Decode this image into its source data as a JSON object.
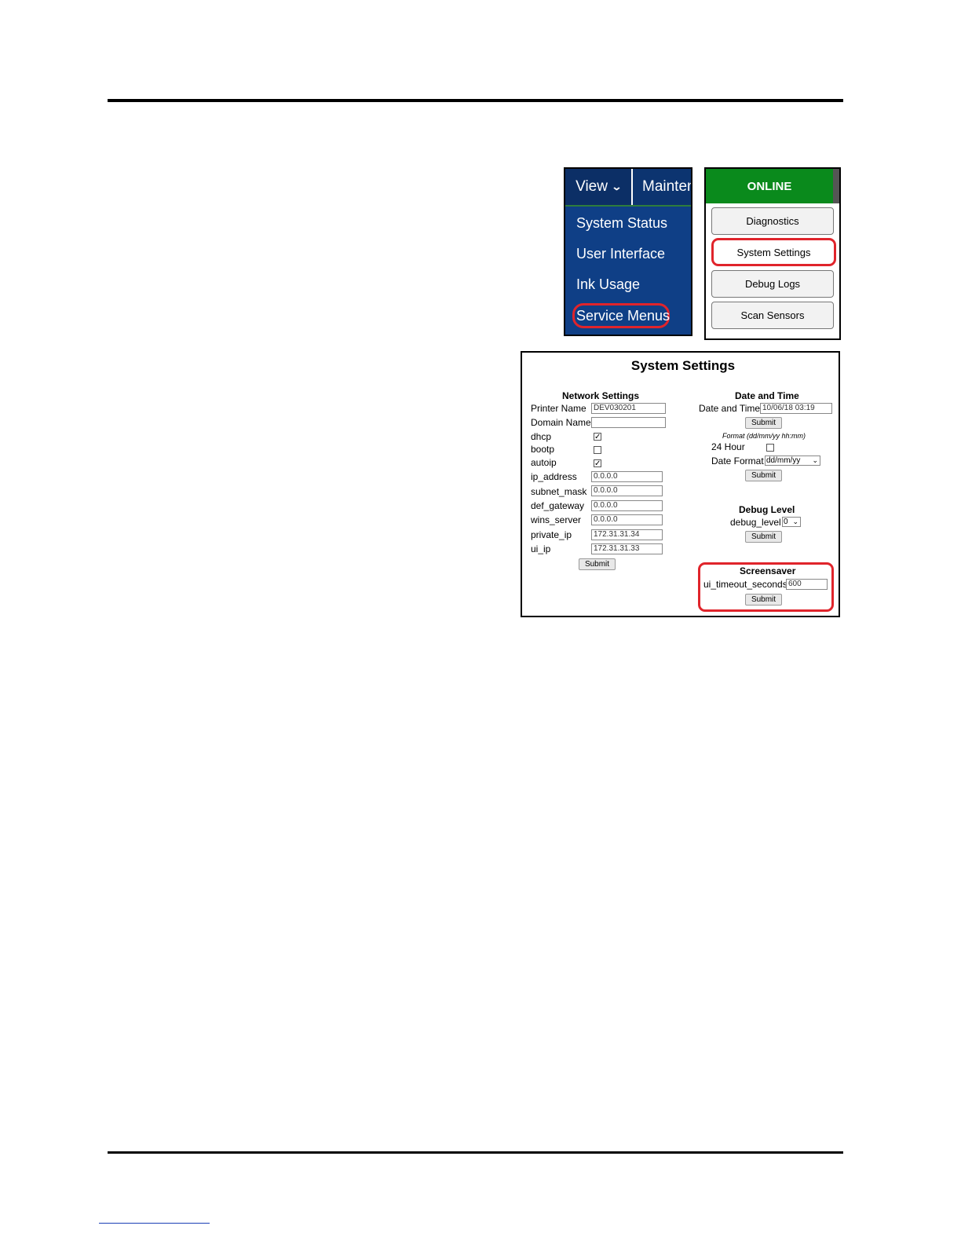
{
  "view_menu": {
    "view_label": "View",
    "maintenance_label": "Mainten",
    "items": [
      "System Status",
      "User Interface",
      "Ink Usage",
      "Service Menus"
    ]
  },
  "online_panel": {
    "status": "ONLINE",
    "buttons": [
      "Diagnostics",
      "System Settings",
      "Debug Logs",
      "Scan Sensors"
    ]
  },
  "system_settings": {
    "title": "System Settings",
    "network": {
      "heading": "Network Settings",
      "printer_name_label": "Printer Name",
      "printer_name_value": "DEV030201",
      "domain_name_label": "Domain Name",
      "domain_name_value": "",
      "dhcp_label": "dhcp",
      "dhcp_checked": true,
      "bootp_label": "bootp",
      "bootp_checked": false,
      "autoip_label": "autoip",
      "autoip_checked": true,
      "ip_address_label": "ip_address",
      "ip_address_value": "0.0.0.0",
      "subnet_mask_label": "subnet_mask",
      "subnet_mask_value": "0.0.0.0",
      "def_gateway_label": "def_gateway",
      "def_gateway_value": "0.0.0.0",
      "wins_server_label": "wins_server",
      "wins_server_value": "0.0.0.0",
      "private_ip_label": "private_ip",
      "private_ip_value": "172.31.31.34",
      "ui_ip_label": "ui_ip",
      "ui_ip_value": "172.31.31.33",
      "submit_label": "Submit"
    },
    "date_time": {
      "heading": "Date and Time",
      "date_time_label": "Date and Time",
      "date_time_value": "10/06/18 03:19",
      "submit_label": "Submit",
      "format_hint": "Format (dd/mm/yy hh:mm)",
      "hour24_label": "24 Hour",
      "hour24_checked": false,
      "date_format_label": "Date Format",
      "date_format_value": "dd/mm/yy",
      "submit2_label": "Submit"
    },
    "debug": {
      "heading": "Debug Level",
      "debug_level_label": "debug_level",
      "debug_level_value": "0",
      "submit_label": "Submit"
    },
    "screensaver": {
      "heading": "Screensaver",
      "timeout_label": "ui_timeout_seconds",
      "timeout_value": "600",
      "submit_label": "Submit"
    }
  },
  "colors": {
    "menu_blue": "#0f3f86",
    "online_green": "#0a8a1c",
    "highlight_red": "#e0242b"
  }
}
